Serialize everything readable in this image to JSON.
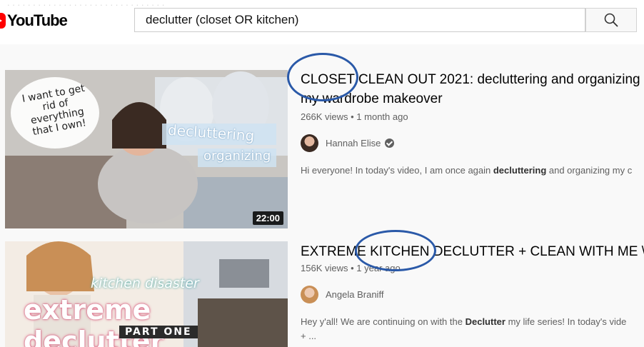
{
  "header": {
    "logo_text": "YouTube",
    "search_value": "declutter (closet OR kitchen)",
    "search_icon": "search-icon"
  },
  "results": [
    {
      "title_line1": "CLOSET CLEAN OUT 2021: decluttering and organizing",
      "title_line2": "my wardrobe makeover",
      "views": "266K views",
      "age": "1 month ago",
      "channel": "Hannah Elise",
      "verified": true,
      "desc_pre": "Hi everyone! In today's video, I am once again ",
      "desc_bold": "decluttering",
      "desc_post": " and organizing my c",
      "duration": "22:00",
      "thumb_text": [
        "I want to get rid of everything that I own!",
        "decluttering",
        "organizing"
      ]
    },
    {
      "title_line1": "EXTREME KITCHEN DECLUTTER + CLEAN WITH ME \\\\",
      "views": "156K views",
      "age": "1 year ago",
      "channel": "Angela Braniff",
      "desc_pre": "Hey y'all! We are continuing on with the ",
      "desc_bold": "Declutter",
      "desc_post": " my life series! In today's vide",
      "desc_line2": "+ ...",
      "thumb_text": [
        "kitchen disaster",
        "extreme declutter",
        "PART ONE"
      ]
    }
  ],
  "colors": {
    "annotation": "#2a59a8",
    "brand_red": "#ff0000"
  },
  "separator": "•"
}
